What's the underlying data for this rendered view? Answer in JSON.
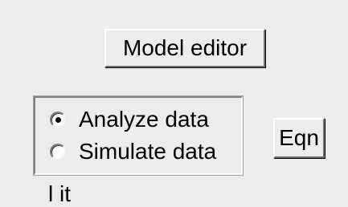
{
  "buttons": {
    "model_editor": "Model editor",
    "eqn": "Eqn"
  },
  "mode": {
    "options": [
      {
        "label": "Analyze data",
        "selected": true
      },
      {
        "label": "Simulate data",
        "selected": false
      }
    ]
  },
  "bottom_label_partial": "l    it"
}
